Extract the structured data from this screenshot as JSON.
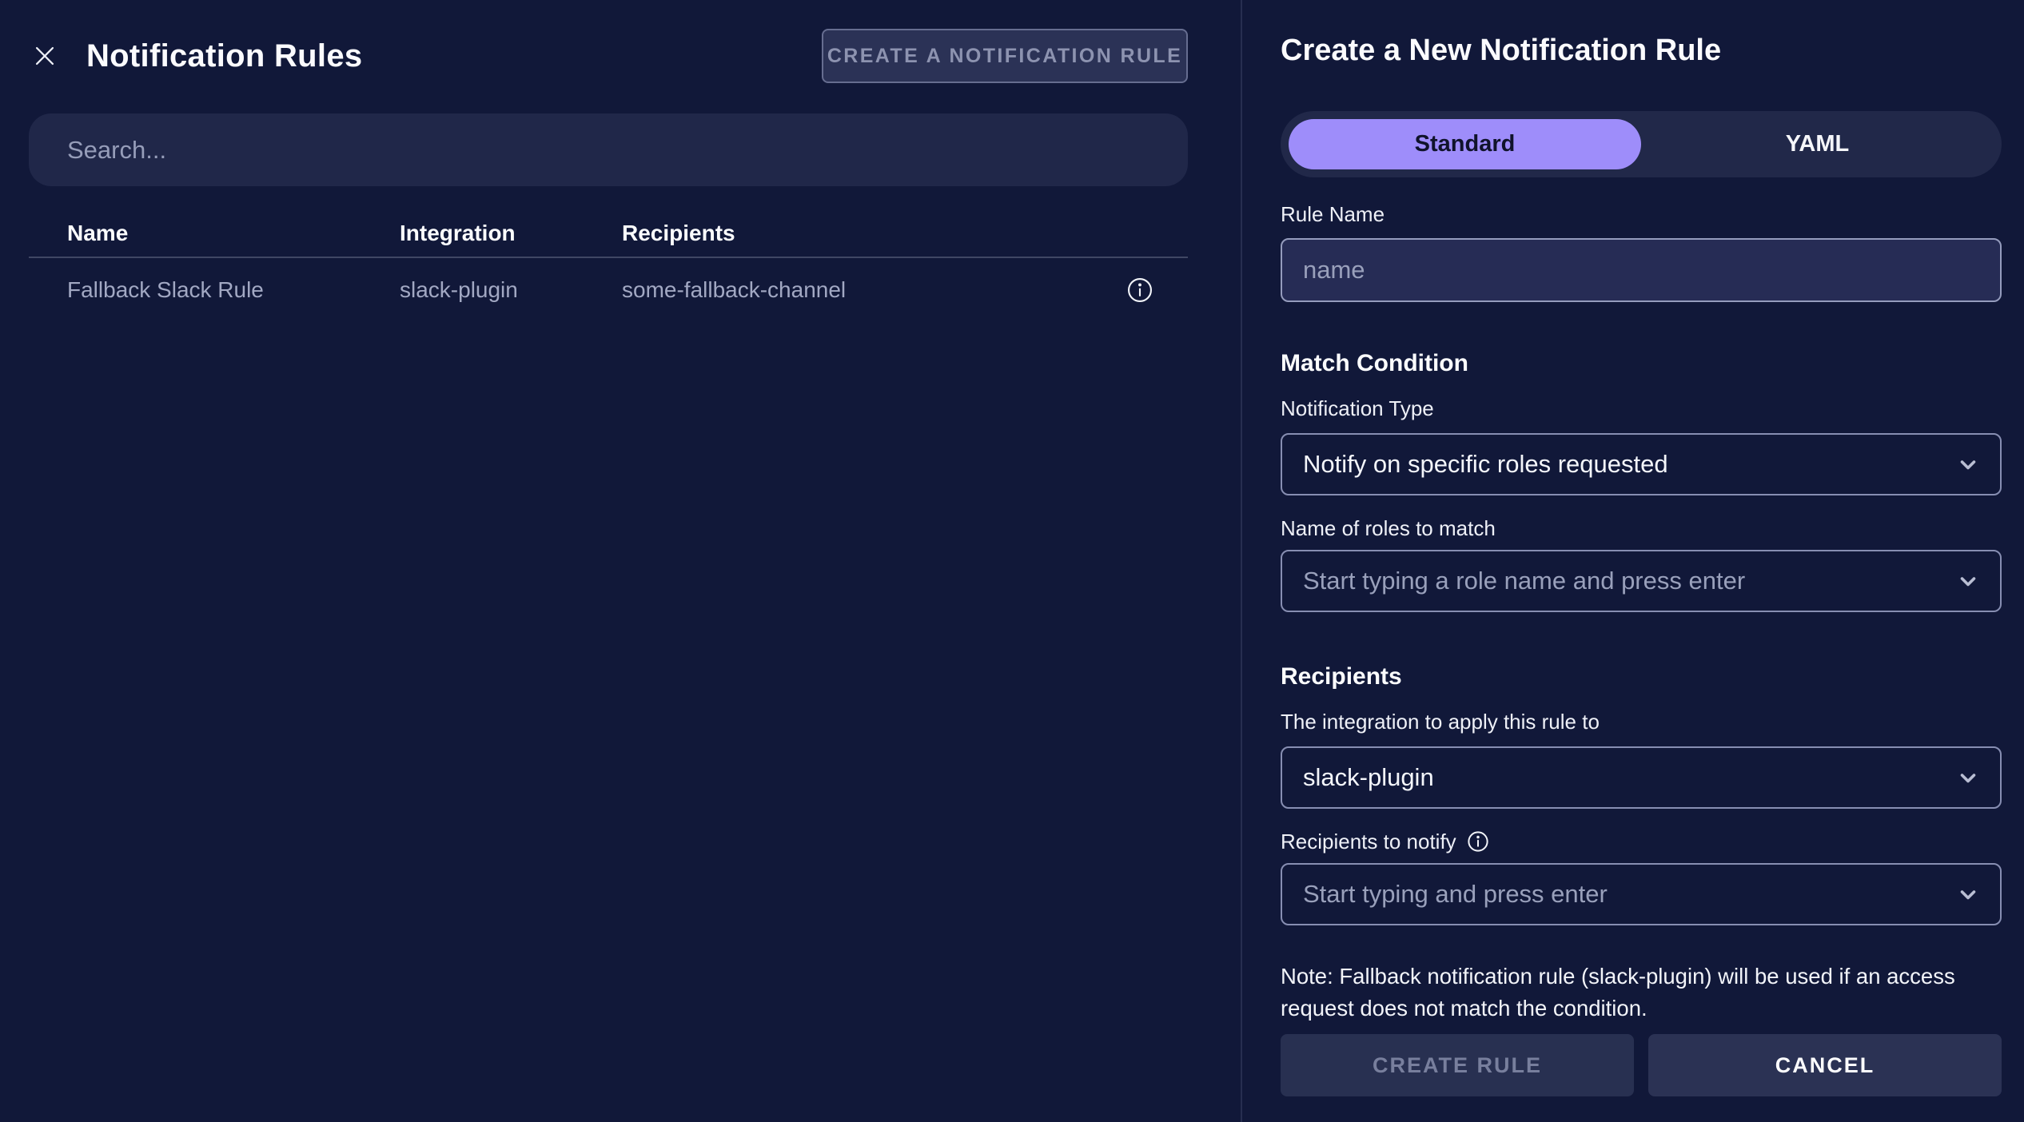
{
  "left_panel": {
    "title": "Notification Rules",
    "create_button_label": "CREATE A NOTIFICATION RULE",
    "search_placeholder": "Search...",
    "table": {
      "columns": [
        "Name",
        "Integration",
        "Recipients"
      ],
      "rows": [
        {
          "name": "Fallback Slack Rule",
          "integration": "slack-plugin",
          "recipients": "some-fallback-channel"
        }
      ]
    }
  },
  "right_panel": {
    "title": "Create a New Notification Rule",
    "tabs": [
      {
        "label": "Standard",
        "active": true
      },
      {
        "label": "YAML",
        "active": false
      }
    ],
    "rule_name": {
      "label": "Rule Name",
      "placeholder": "name"
    },
    "match_condition": {
      "heading": "Match Condition",
      "notification_type": {
        "label": "Notification Type",
        "value": "Notify on specific roles requested"
      },
      "roles": {
        "label": "Name of roles to match",
        "placeholder": "Start typing a role name and press enter"
      }
    },
    "recipients": {
      "heading": "Recipients",
      "integration": {
        "label": "The integration to apply this rule to",
        "value": "slack-plugin"
      },
      "notify": {
        "label": "Recipients to notify",
        "placeholder": "Start typing and press enter"
      }
    },
    "note": "Note: Fallback notification rule (slack-plugin) will be used if an access request does not match the condition.",
    "create_button_label": "CREATE RULE",
    "cancel_button_label": "CANCEL"
  },
  "colors": {
    "background": "#111839",
    "surface": "#212849",
    "input_fill": "#262c55",
    "control_border": "#8f96ba",
    "accent_purple": "#9e8dfa",
    "text_primary": "#ffffff",
    "text_muted": "#99a0bb",
    "text_disabled": "#787f9d",
    "button_fill": "#2b3254"
  }
}
